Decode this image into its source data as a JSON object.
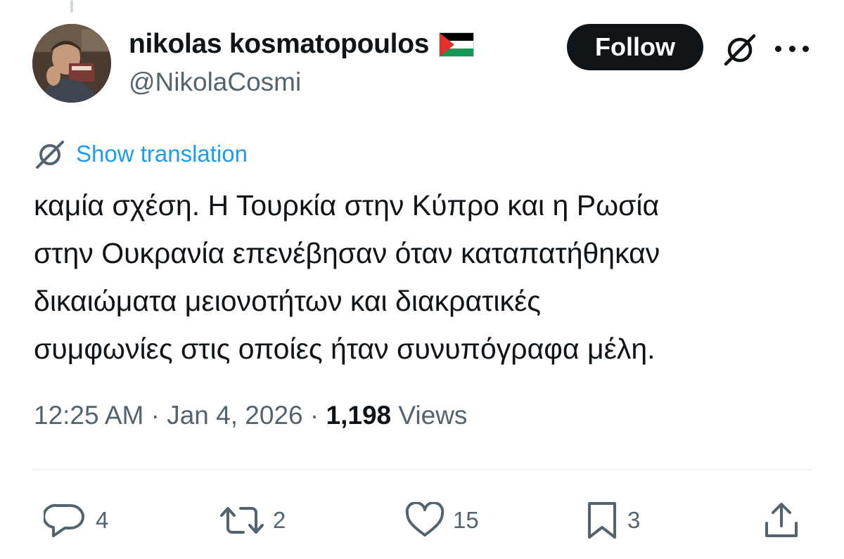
{
  "tweet": {
    "author": {
      "display_name": "nikolas kosmatopoulos",
      "handle": "@NikolaCosmi",
      "flag_icon": "palestine-flag-icon"
    },
    "follow_label": "Follow",
    "show_translation_label": "Show translation",
    "text_lines": [
      "καμία σχέση. Η Τουρκία στην Κύπρο και η Ρωσία",
      "στην Ουκρανία επενέβησαν όταν καταπατήθηκαν",
      "δικαιώματα μειονοτήτων και διακρατικές",
      "συμφωνίες στις οποίες ήταν συνυπόγραφα μέλη."
    ],
    "time": "12:25 AM",
    "date": "Jan 4, 2026",
    "separator": "·",
    "views_count": "1,198",
    "views_label": "Views",
    "actions": {
      "replies": "4",
      "reposts": "2",
      "likes": "15",
      "bookmarks": "3"
    }
  },
  "colors": {
    "text": "#0f1419",
    "secondary": "#536471",
    "link": "#1d9bf0",
    "button_bg": "#0f1419",
    "divider": "#eff3f4"
  }
}
